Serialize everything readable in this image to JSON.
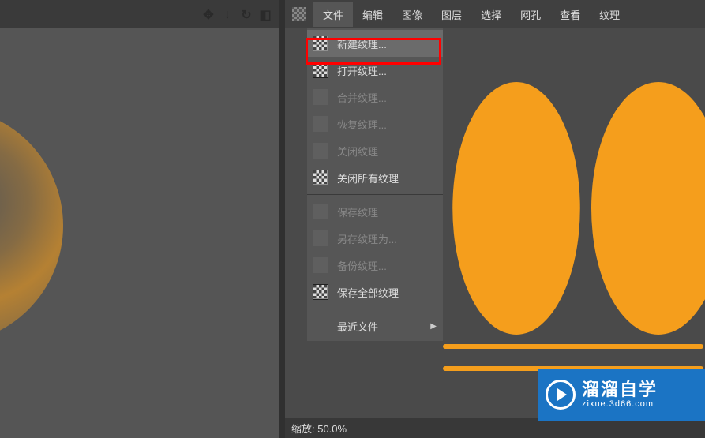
{
  "menubar": {
    "items": [
      {
        "label": "文件",
        "active": true
      },
      {
        "label": "编辑"
      },
      {
        "label": "图像"
      },
      {
        "label": "图层"
      },
      {
        "label": "选择"
      },
      {
        "label": "网孔"
      },
      {
        "label": "查看"
      },
      {
        "label": "纹理"
      }
    ]
  },
  "dropdown": {
    "groups": [
      [
        {
          "label": "新建纹理...",
          "enabled": true,
          "highlighted": true,
          "icon": "new-texture-icon"
        },
        {
          "label": "打开纹理...",
          "enabled": true,
          "icon": "open-texture-icon"
        },
        {
          "label": "合并纹理...",
          "enabled": false,
          "icon": "merge-texture-icon"
        },
        {
          "label": "恢复纹理...",
          "enabled": false,
          "icon": "revert-texture-icon"
        },
        {
          "label": "关闭纹理",
          "enabled": false,
          "icon": "close-texture-icon"
        },
        {
          "label": "关闭所有纹理",
          "enabled": true,
          "icon": "close-all-textures-icon"
        }
      ],
      [
        {
          "label": "保存纹理",
          "enabled": false,
          "icon": "save-texture-icon"
        },
        {
          "label": "另存纹理为...",
          "enabled": false,
          "icon": "save-as-texture-icon"
        },
        {
          "label": "备份纹理...",
          "enabled": false,
          "icon": "backup-texture-icon"
        },
        {
          "label": "保存全部纹理",
          "enabled": true,
          "icon": "save-all-textures-icon"
        }
      ],
      [
        {
          "label": "最近文件",
          "enabled": true,
          "submenu": true,
          "icon": "recent-files-icon"
        }
      ]
    ]
  },
  "statusbar": {
    "zoom_label": "缩放: 50.0%"
  },
  "watermark": {
    "main": "溜溜自学",
    "sub": "zixue.3d66.com"
  },
  "left_toolbar": {
    "icons": [
      "move-icon",
      "down-arrow-icon",
      "refresh-icon",
      "panel-icon"
    ]
  },
  "colors": {
    "uv_orange": "#f59e1c",
    "highlight_red": "#ff0000",
    "brand_blue": "#1b74c4"
  }
}
